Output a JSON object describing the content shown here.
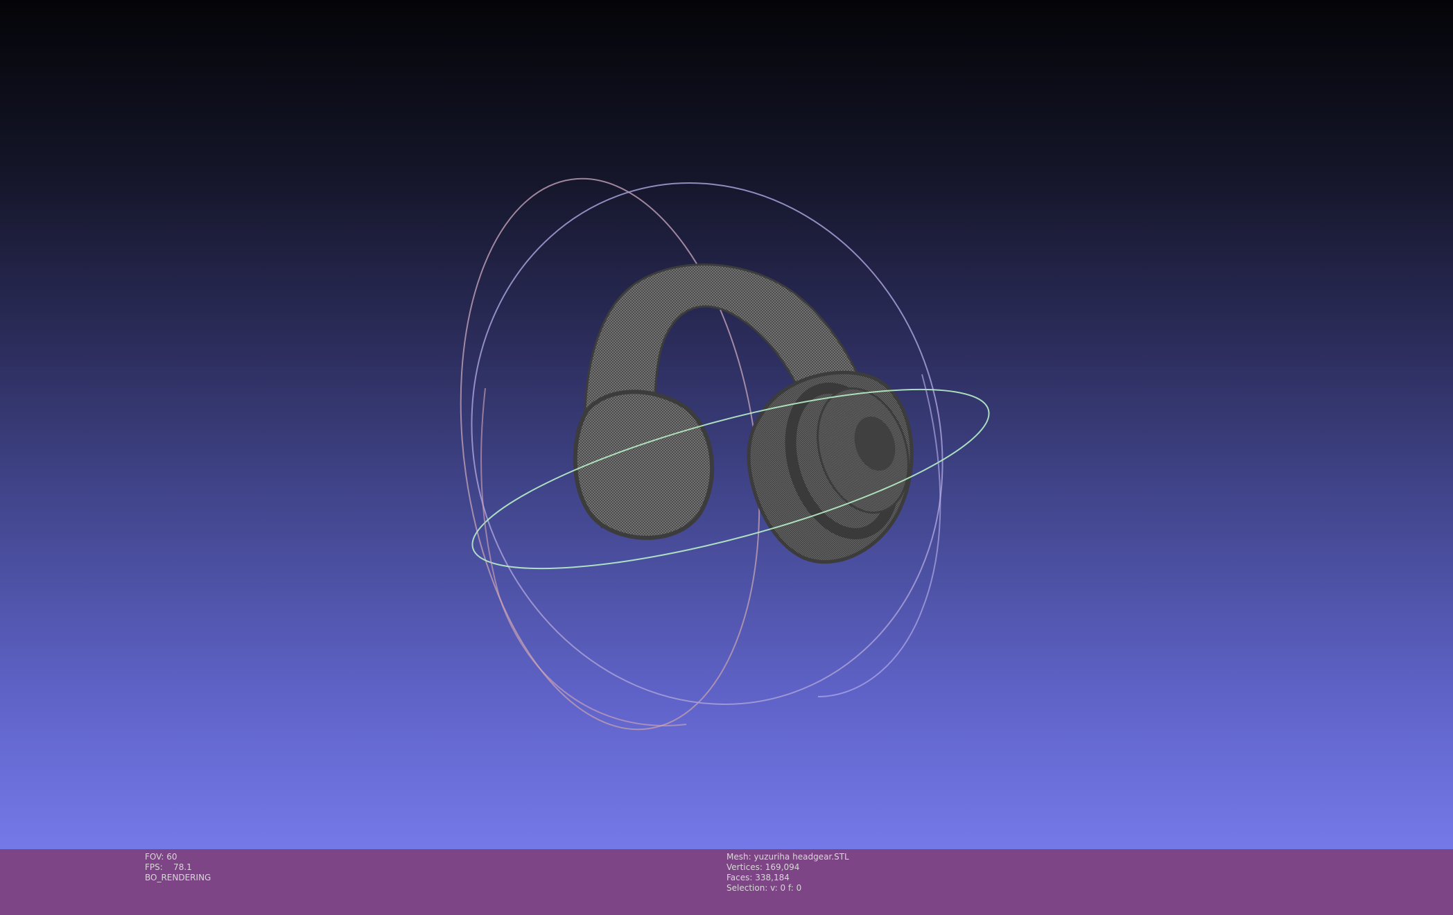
{
  "viewer": {
    "background_top": "#040408",
    "background_bottom": "#7479e8",
    "info_bar_color": "#7d4585",
    "mesh_color": "#4a4a4a",
    "trackball": {
      "x_axis_color": "#e8a0b8",
      "y_axis_color": "#a0a0ff",
      "z_axis_color": "#a0f0b0"
    },
    "model_icon": "headphones-mesh"
  },
  "status": {
    "fov_text": "FOV: 60",
    "fps_text": "FPS:    78.1",
    "render_mode_text": "BO_RENDERING",
    "mesh_text": "Mesh: yuzuriha headgear.STL",
    "vertices_text": "Vertices: 169,094",
    "faces_text": "Faces: 338,184",
    "selection_text": "Selection: v: 0 f: 0"
  }
}
